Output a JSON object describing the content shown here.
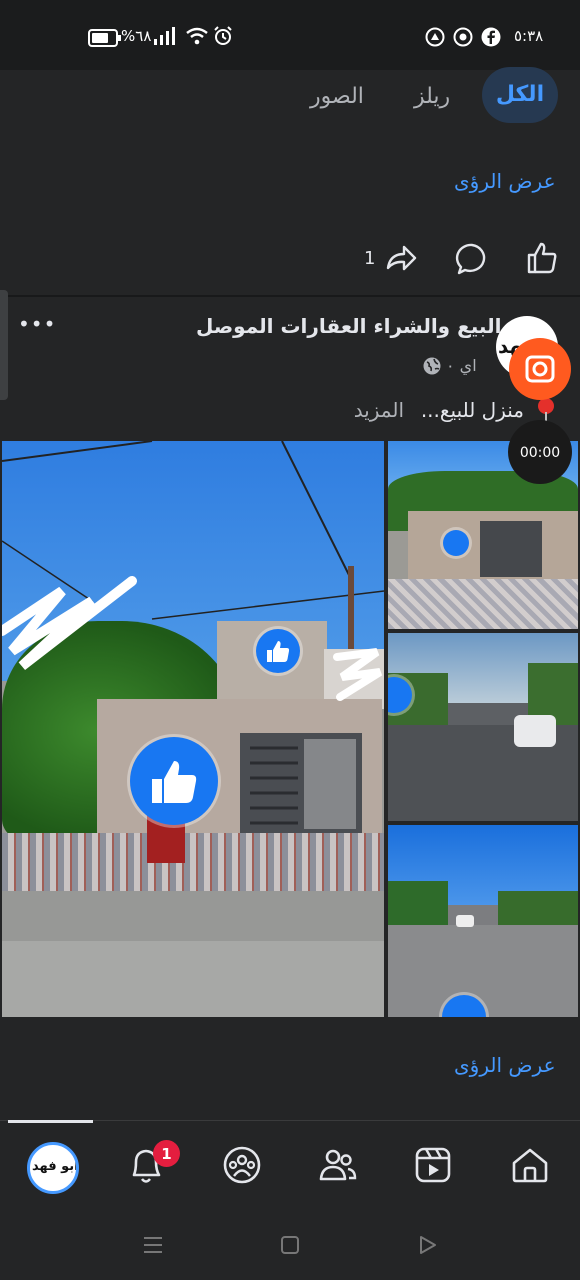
{
  "status_bar": {
    "time": "٥:٣٨",
    "battery": "%٦٨"
  },
  "tabs": [
    {
      "label": "الكل",
      "active": true
    },
    {
      "label": "ريلز",
      "active": false
    },
    {
      "label": "الصور",
      "active": false
    }
  ],
  "previous_post": {
    "view_insights": "عرض الرؤى",
    "share_count": "1"
  },
  "post": {
    "page_name": "البيع والشراء العقارات الموصل",
    "avatar_text": "بو فهد",
    "meta": "اي ٠",
    "text": "منزل للبيع...",
    "more_label": "المزيد",
    "view_insights": "عرض الرؤى",
    "more_options": "•••"
  },
  "recorder": {
    "timer": "00:00"
  },
  "bottom_nav": {
    "profile_avatar_text": "ابو فهد",
    "notification_badge": "1",
    "items": [
      "profile",
      "notifications",
      "groups",
      "friends",
      "reels",
      "home"
    ]
  },
  "colors": {
    "background": "#242526",
    "accent": "#4599ff",
    "like_blue": "#1877f2",
    "badge_red": "#e41e3f",
    "recorder_orange": "#ff5a1f"
  }
}
